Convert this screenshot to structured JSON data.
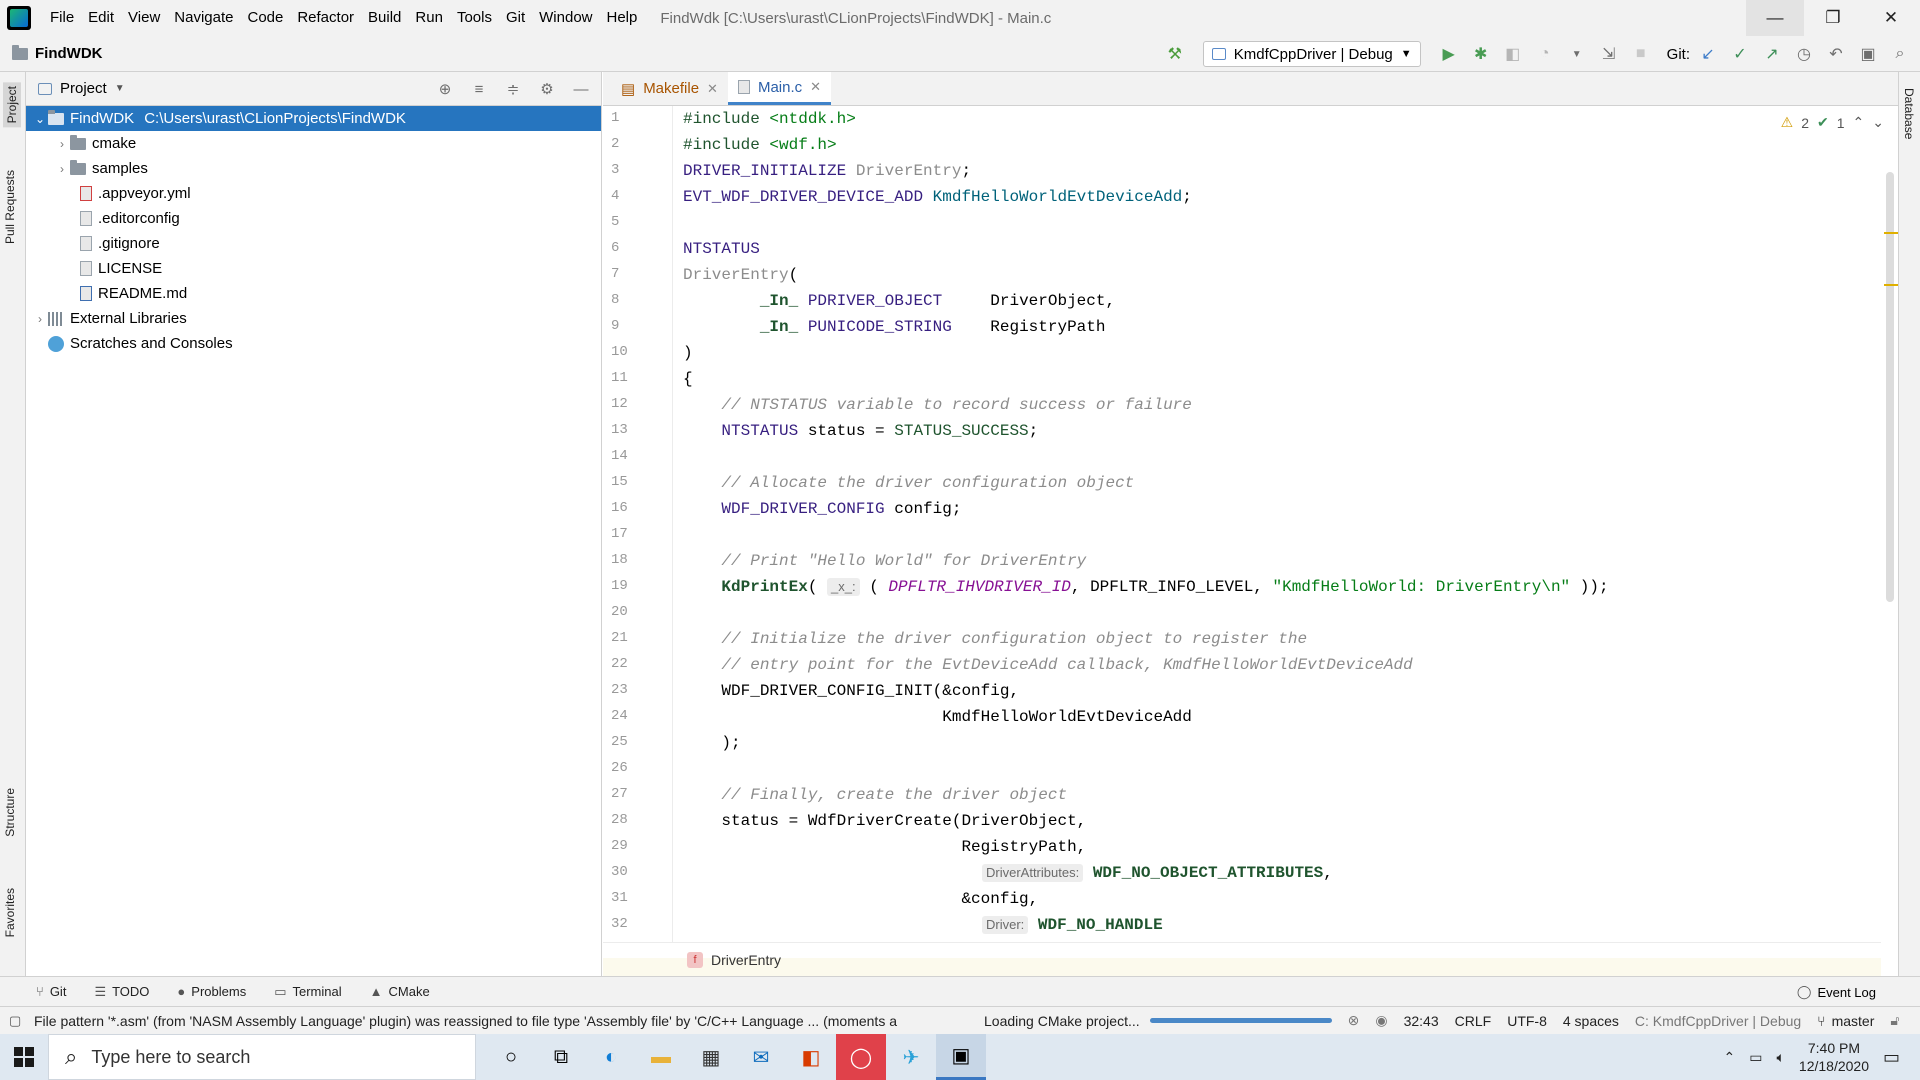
{
  "window": {
    "menu": [
      "File",
      "Edit",
      "View",
      "Navigate",
      "Code",
      "Refactor",
      "Build",
      "Run",
      "Tools",
      "Git",
      "Window",
      "Help"
    ],
    "title": "FindWdk [C:\\Users\\urast\\CLionProjects\\FindWDK] - Main.c",
    "minimize": "—",
    "maximize": "❐",
    "close": "✕"
  },
  "toolbar": {
    "project_name": "FindWDK",
    "run_config": "KmdfCppDriver | Debug",
    "git_label": "Git:"
  },
  "left_stripe": {
    "project": "Project",
    "pull_requests": "Pull Requests",
    "structure": "Structure",
    "favorites": "Favorites"
  },
  "right_stripe": {
    "database": "Database"
  },
  "project_panel": {
    "title": "Project",
    "root": {
      "name": "FindWDK",
      "path": "C:\\Users\\urast\\CLionProjects\\FindWDK"
    },
    "items": [
      {
        "label": "cmake",
        "kind": "folder"
      },
      {
        "label": "samples",
        "kind": "folder"
      },
      {
        "label": ".appveyor.yml",
        "kind": "file"
      },
      {
        "label": ".editorconfig",
        "kind": "file"
      },
      {
        "label": ".gitignore",
        "kind": "file"
      },
      {
        "label": "LICENSE",
        "kind": "file"
      },
      {
        "label": "README.md",
        "kind": "file"
      }
    ],
    "external_libraries": "External Libraries",
    "scratches": "Scratches and Consoles"
  },
  "editor": {
    "tabs": [
      {
        "label": "Makefile"
      },
      {
        "label": "Main.c"
      }
    ],
    "warnings": "2",
    "ok_count": "1",
    "line_numbers": [
      "1",
      "2",
      "3",
      "4",
      "5",
      "6",
      "7",
      "8",
      "9",
      "10",
      "11",
      "12",
      "13",
      "14",
      "15",
      "16",
      "17",
      "18",
      "19",
      "20",
      "21",
      "22",
      "23",
      "24",
      "25",
      "26",
      "27",
      "28",
      "29",
      "30",
      "31",
      "32"
    ],
    "code": {
      "l1a": "#include ",
      "l1b": "<ntddk.h>",
      "l2a": "#include ",
      "l2b": "<wdf.h>",
      "l3a": "DRIVER_INITIALIZE ",
      "l3b": "DriverEntry",
      "l3c": ";",
      "l4a": "EVT_WDF_DRIVER_DEVICE_ADD ",
      "l4b": "KmdfHelloWorldEvtDeviceAdd",
      "l4c": ";",
      "l6": "NTSTATUS",
      "l7a": "DriverEntry",
      "l7b": "(",
      "l8a": "        _In_ ",
      "l8b": "PDRIVER_OBJECT",
      "l8c": "     DriverObject,",
      "l9a": "        _In_ ",
      "l9b": "PUNICODE_STRING",
      "l9c": "    RegistryPath",
      "l10": ")",
      "l11": "{",
      "l12": "    // NTSTATUS variable to record success or failure",
      "l13a": "    NTSTATUS",
      "l13b": " status = ",
      "l13c": "STATUS_SUCCESS",
      "l13d": ";",
      "l15": "    // Allocate the driver configuration object",
      "l16a": "    WDF_DRIVER_CONFIG",
      "l16b": " config;",
      "l18": "    // Print \"Hello World\" for DriverEntry",
      "l19a": "    KdPrintEx",
      "l19b": "( ",
      "l19hint": "_x_:",
      "l19c": " ( ",
      "l19d": "DPFLTR_IHVDRIVER_ID",
      "l19e": ", DPFLTR_INFO_LEVEL, ",
      "l19f": "\"KmdfHelloWorld: DriverEntry\\n\"",
      "l19g": " ));",
      "l21": "    // Initialize the driver configuration object to register the",
      "l22": "    // entry point for the EvtDeviceAdd callback, KmdfHelloWorldEvtDeviceAdd",
      "l23": "    WDF_DRIVER_CONFIG_INIT(&config,",
      "l24": "                           KmdfHelloWorldEvtDeviceAdd",
      "l25": "    );",
      "l27": "    // Finally, create the driver object",
      "l28": "    status = WdfDriverCreate(DriverObject,",
      "l29": "                             RegistryPath,",
      "l30hint": "DriverAttributes:",
      "l30b": "WDF_NO_OBJECT_ATTRIBUTES",
      "l30c": ",",
      "l31": "                             &config,",
      "l32hint": "Driver:",
      "l32b": "WDF_NO_HANDLE"
    },
    "breadcrumb": "DriverEntry"
  },
  "bottom_tools": {
    "git": "Git",
    "todo": "TODO",
    "problems": "Problems",
    "terminal": "Terminal",
    "cmake": "CMake",
    "event_log": "Event Log"
  },
  "status": {
    "message": "File pattern '*.asm' (from 'NASM Assembly Language' plugin) was reassigned to file type 'Assembly file' by 'C/C++ Language ... (moments a",
    "loading": "Loading CMake project...",
    "position": "32:43",
    "line_sep": "CRLF",
    "encoding": "UTF-8",
    "indent": "4 spaces",
    "context": "C: KmdfCppDriver | Debug",
    "branch": "master"
  },
  "taskbar": {
    "search_placeholder": "Type here to search",
    "time": "7:40 PM",
    "date": "12/18/2020"
  }
}
